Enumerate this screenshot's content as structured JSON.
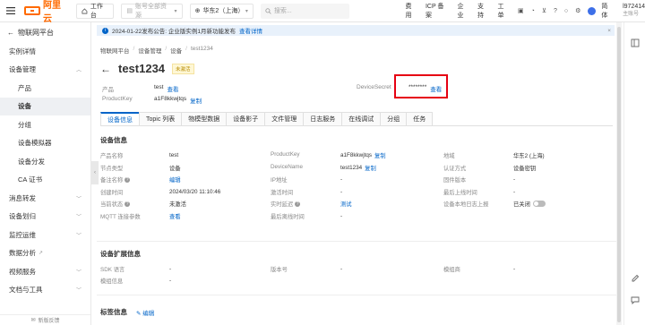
{
  "topbar": {
    "logo_text": "阿里云",
    "workbench": "工作台",
    "resource_group": "账号全部资源",
    "region": "华东2（上海）",
    "search_placeholder": "搜索...",
    "links": [
      "费用",
      "ICP 备案",
      "企业",
      "支持",
      "工单"
    ],
    "user_id": "l972414",
    "user_role": "主账号",
    "lang": "简体"
  },
  "sidebar": {
    "header": "物联网平台",
    "items": [
      {
        "label": "实例详情",
        "sub": false,
        "chevron": false,
        "active": false
      },
      {
        "label": "设备管理",
        "sub": false,
        "chevron": "up",
        "active": false
      },
      {
        "label": "产品",
        "sub": true,
        "chevron": false,
        "active": false
      },
      {
        "label": "设备",
        "sub": true,
        "chevron": false,
        "active": true
      },
      {
        "label": "分组",
        "sub": true,
        "chevron": false,
        "active": false
      },
      {
        "label": "设备模拟器",
        "sub": true,
        "chevron": false,
        "active": false
      },
      {
        "label": "设备分发",
        "sub": true,
        "chevron": false,
        "active": false
      },
      {
        "label": "CA 证书",
        "sub": true,
        "chevron": false,
        "active": false
      },
      {
        "label": "消息转发",
        "sub": false,
        "chevron": "down",
        "active": false
      },
      {
        "label": "设备划归",
        "sub": false,
        "chevron": "down",
        "active": false
      },
      {
        "label": "监控运维",
        "sub": false,
        "chevron": "down",
        "active": false
      },
      {
        "label": "数据分析",
        "sub": false,
        "chevron": "ext",
        "active": false
      },
      {
        "label": "视频服务",
        "sub": false,
        "chevron": "down",
        "active": false
      },
      {
        "label": "文档与工具",
        "sub": false,
        "chevron": "down",
        "active": false
      }
    ],
    "footer": "新版反馈"
  },
  "notice": {
    "text": "2024-01-22发布公告: 企业版实例1月新功能发布",
    "link": "查看详情"
  },
  "breadcrumb": [
    "物联网平台",
    "设备管理",
    "设备",
    "test1234"
  ],
  "device": {
    "name": "test1234",
    "status_badge": "未激活",
    "product_label": "产品",
    "product_value": "test",
    "product_link": "查看",
    "pk_label": "ProductKey",
    "pk_value": "a1F8kkwjtqs",
    "pk_copy": "复制",
    "secret_label": "DeviceSecret",
    "secret_value": "********",
    "secret_link": "查看"
  },
  "tabs": [
    "设备信息",
    "Topic 列表",
    "物模型数据",
    "设备影子",
    "文件管理",
    "日志服务",
    "在线调试",
    "分组",
    "任务"
  ],
  "device_info": {
    "title": "设备信息",
    "rows": [
      [
        {
          "k": "产品名称",
          "v": "test"
        },
        {
          "k": "ProductKey",
          "v": "a1F8kkwjtqs",
          "link": "复制"
        },
        {
          "k": "地域",
          "v": "华东2 (上海)"
        }
      ],
      [
        {
          "k": "节点类型",
          "v": "设备"
        },
        {
          "k": "DeviceName",
          "v": "test1234",
          "link": "复制"
        },
        {
          "k": "认证方式",
          "v": "设备密钥"
        }
      ],
      [
        {
          "k": "备注名称",
          "v": "",
          "link": "编辑",
          "q": true
        },
        {
          "k": "IP地址",
          "v": "-"
        },
        {
          "k": "固件版本",
          "v": "-"
        }
      ],
      [
        {
          "k": "创建时间",
          "v": "2024/03/20 11:10:46"
        },
        {
          "k": "激活时间",
          "v": "-"
        },
        {
          "k": "最后上线时间",
          "v": "-"
        }
      ],
      [
        {
          "k": "当前状态",
          "v": "未激活",
          "q": true
        },
        {
          "k": "实时延迟",
          "v": "",
          "link": "测试",
          "q": true
        },
        {
          "k": "设备本地日志上报",
          "v": "已关闭",
          "toggle": true
        }
      ],
      [
        {
          "k": "MQTT 连接参数",
          "v": "",
          "link": "查看"
        },
        {
          "k": "最后离线时间",
          "v": "-"
        }
      ]
    ]
  },
  "ext_info": {
    "title": "设备扩展信息",
    "rows": [
      [
        {
          "k": "SDK 语言",
          "v": "-"
        },
        {
          "k": "版本号",
          "v": "-"
        },
        {
          "k": "模组商",
          "v": "-"
        }
      ],
      [
        {
          "k": "模组信息",
          "v": "-"
        }
      ]
    ]
  },
  "tag_info": {
    "title": "标签信息",
    "edit": "编辑"
  }
}
